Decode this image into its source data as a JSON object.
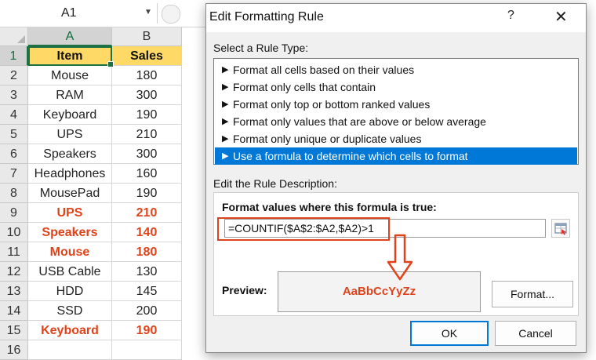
{
  "name_box": {
    "value": "A1"
  },
  "columns": [
    "A",
    "B"
  ],
  "rows": [
    {
      "num": "1",
      "item": "Item",
      "sales": "Sales"
    },
    {
      "num": "2",
      "item": "Mouse",
      "sales": "180"
    },
    {
      "num": "3",
      "item": "RAM",
      "sales": "300"
    },
    {
      "num": "4",
      "item": "Keyboard",
      "sales": "190"
    },
    {
      "num": "5",
      "item": "UPS",
      "sales": "210"
    },
    {
      "num": "6",
      "item": "Speakers",
      "sales": "300"
    },
    {
      "num": "7",
      "item": "Headphones",
      "sales": "160"
    },
    {
      "num": "8",
      "item": "MousePad",
      "sales": "190"
    },
    {
      "num": "9",
      "item": "UPS",
      "sales": "210"
    },
    {
      "num": "10",
      "item": "Speakers",
      "sales": "140"
    },
    {
      "num": "11",
      "item": "Mouse",
      "sales": "180"
    },
    {
      "num": "12",
      "item": "USB Cable",
      "sales": "130"
    },
    {
      "num": "13",
      "item": "HDD",
      "sales": "145"
    },
    {
      "num": "14",
      "item": "SSD",
      "sales": "200"
    },
    {
      "num": "15",
      "item": "Keyboard",
      "sales": "190"
    },
    {
      "num": "16",
      "item": "",
      "sales": ""
    }
  ],
  "highlighted_rows": [
    9,
    10,
    11,
    15
  ],
  "colors": {
    "header_fill": "#ffd966",
    "duplicate_text": "#e0431a",
    "selection": "#1e7145",
    "accent": "#0078d7"
  },
  "dialog": {
    "title": "Edit Formatting Rule",
    "help_icon": "?",
    "close_icon": "✕",
    "select_rule_type_label": "Select a Rule Type:",
    "rule_types": [
      "Format all cells based on their values",
      "Format only cells that contain",
      "Format only top or bottom ranked values",
      "Format only values that are above or below average",
      "Format only unique or duplicate values",
      "Use a formula to determine which cells to format"
    ],
    "selected_rule_index": 5,
    "edit_description_label": "Edit the Rule Description:",
    "formula_label": "Format values where this formula is true:",
    "formula": "=COUNTIF($A$2:$A2,$A2)>1",
    "preview_label": "Preview:",
    "preview_text": "AaBbCcYyZz",
    "format_button": "Format...",
    "ok_button": "OK",
    "cancel_button": "Cancel"
  }
}
